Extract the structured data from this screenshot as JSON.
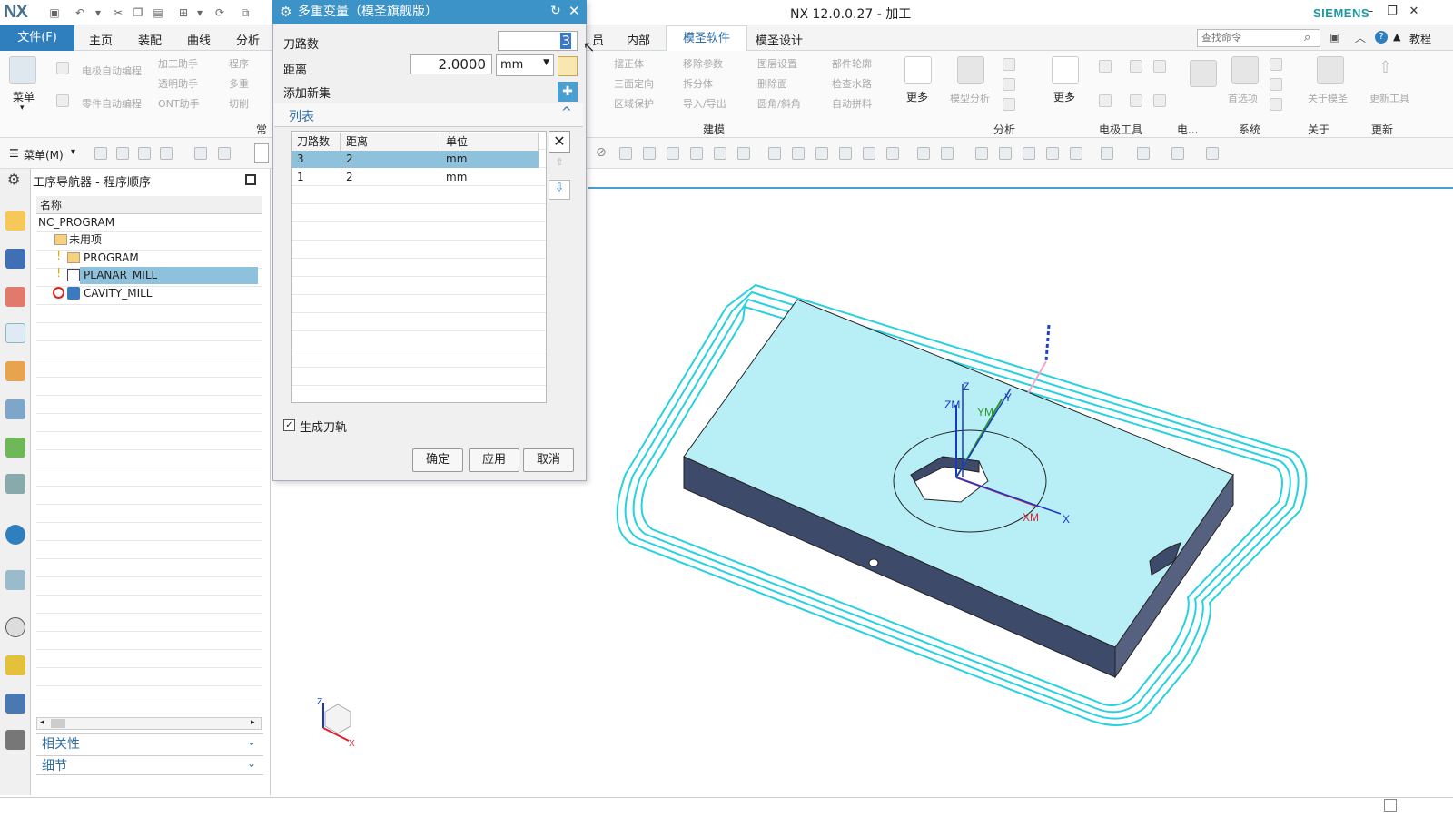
{
  "app": {
    "logo": "NX",
    "title": "NX 12.0.0.27 - 加工",
    "brand": "SIEMENS",
    "tutorial": "教程",
    "accent": "#2f7fbf"
  },
  "tabs": {
    "file": "文件(F)",
    "items": [
      "主页",
      "装配",
      "曲线",
      "分析"
    ],
    "after_dialog": [
      "员",
      "内部"
    ],
    "active": "模圣软件",
    "next": "模圣设计"
  },
  "search": {
    "placeholder": "查找命令"
  },
  "ribbon": {
    "menu_label": "菜单",
    "left_cmds": [
      "电极自动编程",
      "零件自动编程",
      "加工助手",
      "透明助手",
      "ONT助手",
      "程序",
      "多重",
      "切削"
    ],
    "common_group": "常",
    "model_cmds": [
      "摆正体",
      "三面定向",
      "区域保护",
      "移除参数",
      "拆分体",
      "导入/导出",
      "图层设置",
      "删除面",
      "圆角/斜角",
      "部件轮廓",
      "检查水路",
      "自动拼料"
    ],
    "more1": "更多",
    "model_analysis": "模型分析",
    "more2": "更多",
    "prefs": "首选项",
    "about": "关于模圣",
    "update": "更新工具",
    "groups": [
      "建模",
      "分析",
      "电极工具",
      "电...",
      "系统",
      "关于",
      "更新"
    ]
  },
  "toolbar": {
    "menu_button": "菜单(M)"
  },
  "navigator": {
    "title": "工序导航器 - 程序顺序",
    "column": "名称",
    "root": "NC_PROGRAM",
    "items": [
      "未用项",
      "PROGRAM",
      "PLANAR_MILL",
      "CAVITY_MILL"
    ],
    "selected": "PLANAR_MILL",
    "sections": [
      "相关性",
      "细节"
    ]
  },
  "dialog": {
    "title": "多重变量（模圣旗舰版）",
    "paths_label": "刀路数",
    "paths_value": "3",
    "distance_label": "距离",
    "distance_value": "2.0000",
    "unit": "mm",
    "add_set_label": "添加新集",
    "list_label": "列表",
    "columns": [
      "刀路数",
      "距离",
      "单位"
    ],
    "rows": [
      {
        "paths": "3",
        "distance": "2",
        "unit": "mm"
      },
      {
        "paths": "1",
        "distance": "2",
        "unit": "mm"
      }
    ],
    "generate_label": "生成刀轨",
    "generate_checked": true,
    "ok": "确定",
    "apply": "应用",
    "cancel": "取消"
  },
  "viewport": {
    "axis_labels": [
      "Z",
      "ZM",
      "YM",
      "Y",
      "XM",
      "X"
    ],
    "triad_labels": [
      "Z",
      "X"
    ]
  }
}
